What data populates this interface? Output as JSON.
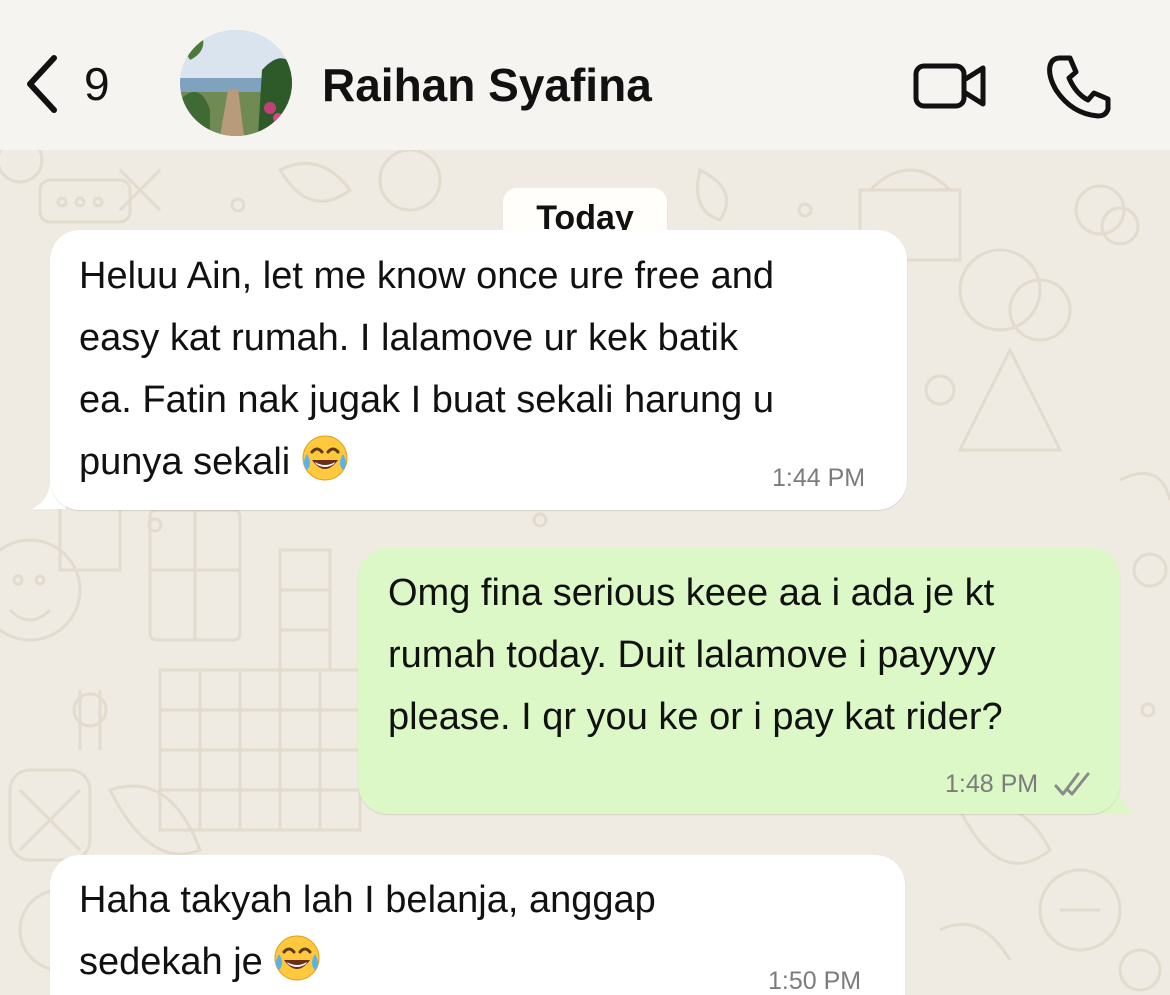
{
  "header": {
    "back_count": "9",
    "contact_name": "Raihan Syafina",
    "back_icon": "chevron-left-icon",
    "video_icon": "video-camera-icon",
    "call_icon": "phone-icon"
  },
  "chat": {
    "date_label": "Today",
    "messages": [
      {
        "direction": "incoming",
        "text": "Heluu Ain, let me know once ure free and\neasy kat rumah. I lalamove ur kek batik\nea. Fatin nak jugak I buat sekali harung u\npunya sekali",
        "emoji": "😂",
        "time": "1:44 PM"
      },
      {
        "direction": "outgoing",
        "text": "Omg fina serious keee aa i ada je kt\nrumah today. Duit lalamove i payyyy\nplease. I qr you ke or i pay kat rider?",
        "time": "1:48 PM",
        "status_icon": "double-check-icon"
      },
      {
        "direction": "incoming",
        "text": "Haha takyah lah I belanja, anggap\nsedekah je",
        "emoji": "😂",
        "time": "1:50 PM"
      }
    ]
  },
  "colors": {
    "incoming_bubble": "#ffffff",
    "outgoing_bubble": "#dcf8c6",
    "chat_background": "#efeae2",
    "header_background": "#f5f4f1"
  }
}
